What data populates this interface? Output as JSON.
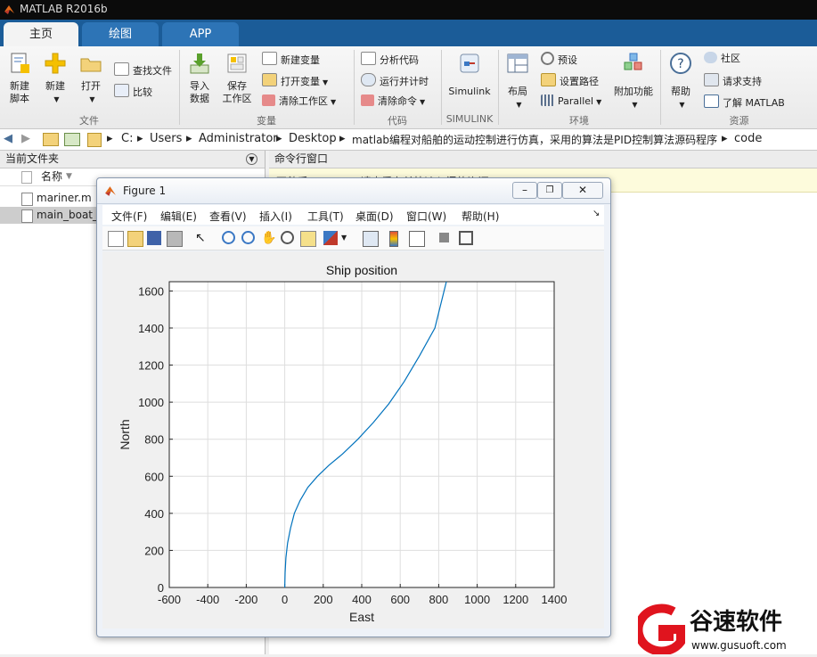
{
  "window": {
    "title": "MATLAB R2016b"
  },
  "tabs": [
    {
      "label": "主页"
    },
    {
      "label": "绘图"
    },
    {
      "label": "APP"
    }
  ],
  "ribbon": {
    "groups": {
      "file": "文件",
      "variable": "变量",
      "code": "代码",
      "simulink": "SIMULINK",
      "environment": "环境",
      "resources": "资源"
    },
    "new_script": [
      "新建",
      "脚本"
    ],
    "new": "新建",
    "open": "打开",
    "find_files": "查找文件",
    "compare": "比较",
    "import_data": [
      "导入",
      "数据"
    ],
    "save_workspace": [
      "保存",
      "工作区"
    ],
    "new_variable": "新建变量",
    "open_variable": "打开变量",
    "clear_workspace": "清除工作区",
    "analyze_code": "分析代码",
    "run_and_time": "运行并计时",
    "clear_commands": "清除命令",
    "simulink": "Simulink",
    "layout": "布局",
    "preferences": "预设",
    "set_path": "设置路径",
    "parallel": "Parallel",
    "addons": "附加功能",
    "help": "帮助",
    "community": "社区",
    "request_support": "请求支持",
    "learn_matlab": "了解 MATLAB"
  },
  "address": {
    "crumbs": [
      "C:",
      "Users",
      "Administrator",
      "Desktop",
      "matlab编程对船舶的运动控制进行仿真，采用的算法是PID控制算法源码程序",
      "code"
    ]
  },
  "current_folder": {
    "title": "当前文件夹",
    "column_name": "名称",
    "files": [
      {
        "name": "mariner.m",
        "selected": false
      },
      {
        "name": "main_boat_l",
        "selected": true
      }
    ]
  },
  "command_window": {
    "title": "命令行窗口",
    "banner": "不熟悉 MATLAB?请查看有关快速入门的资源。"
  },
  "figure": {
    "title": "Figure 1",
    "menu": [
      "文件(F)",
      "编辑(E)",
      "查看(V)",
      "插入(I)",
      "工具(T)",
      "桌面(D)",
      "窗口(W)",
      "帮助(H)"
    ],
    "toolbar_icons": [
      "new-figure-icon",
      "open-file-icon",
      "save-icon",
      "print-icon",
      "pointer-icon",
      "zoom-in-icon",
      "zoom-out-icon",
      "pan-icon",
      "rotate-icon",
      "data-cursor-icon",
      "brush-icon",
      "link-plot-icon",
      "colorbar-icon",
      "legend-icon",
      "hide-plot-tools-icon",
      "show-plot-tools-icon"
    ]
  },
  "chart_data": {
    "type": "line",
    "title": "Ship position",
    "xlabel": "East",
    "ylabel": "North",
    "xlim": [
      -600,
      1400
    ],
    "ylim": [
      0,
      1650
    ],
    "xticks": [
      -600,
      -400,
      -200,
      0,
      200,
      400,
      600,
      800,
      1000,
      1200,
      1400
    ],
    "yticks": [
      0,
      200,
      400,
      600,
      800,
      1000,
      1200,
      1400,
      1600
    ],
    "grid": true,
    "color": "#0072BD",
    "series": [
      {
        "x": [
          0,
          2,
          6,
          15,
          30,
          50,
          80,
          120,
          170,
          230,
          300,
          380,
          460,
          540,
          620,
          700,
          780,
          840
        ],
        "y": [
          0,
          80,
          160,
          240,
          320,
          400,
          470,
          540,
          600,
          660,
          720,
          800,
          890,
          990,
          1110,
          1250,
          1400,
          1650
        ]
      }
    ]
  },
  "watermark": {
    "brand": "谷速软件",
    "url": "www.gusuoft.com",
    "accent": "#e0141e"
  }
}
